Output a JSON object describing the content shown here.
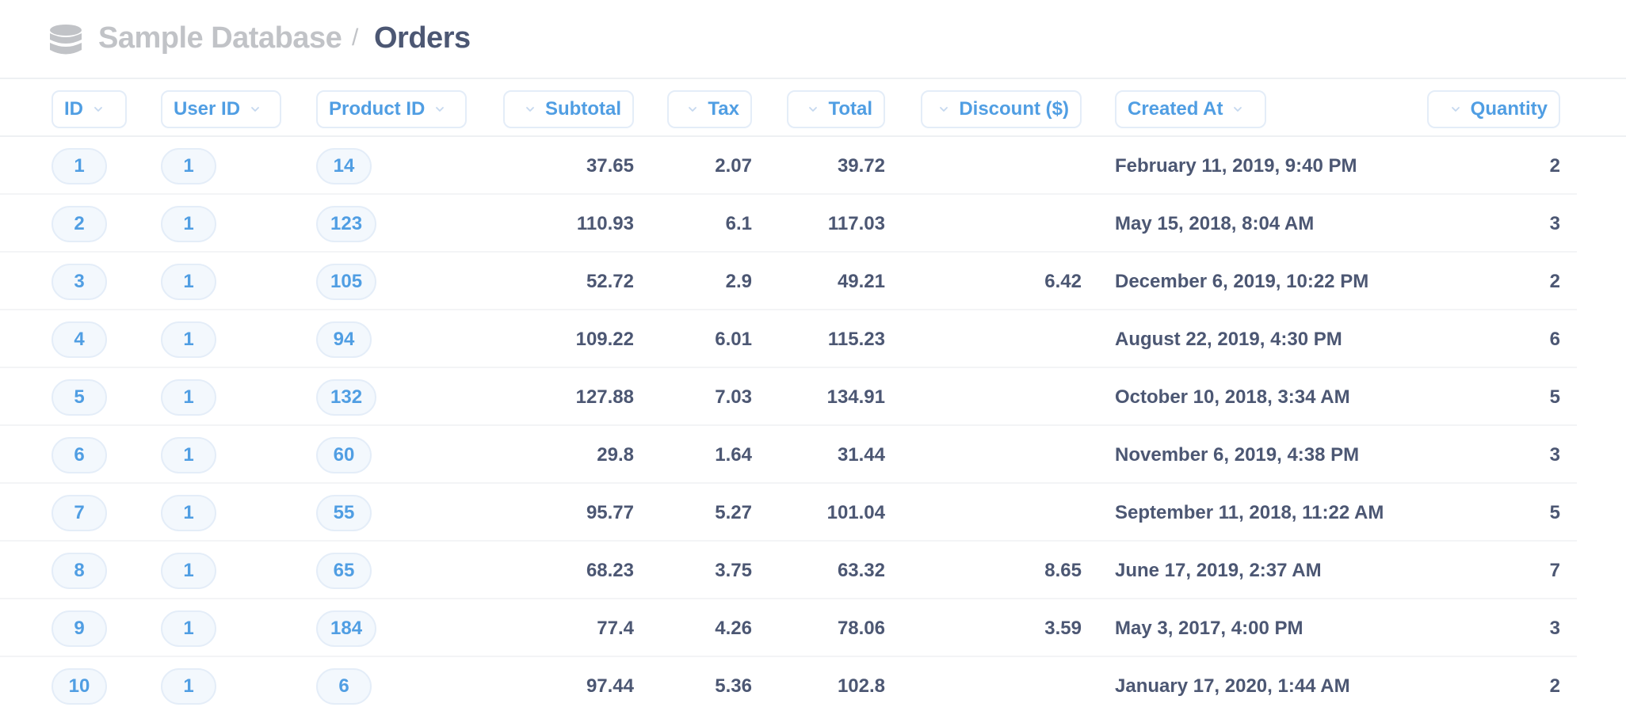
{
  "breadcrumb": {
    "database": "Sample Database",
    "separator": "/",
    "table": "Orders",
    "icon": "database-icon"
  },
  "colors": {
    "accent": "#509ee3",
    "text_dark": "#4c5773",
    "text_muted": "#c1c3c7",
    "pill_bg": "#f3f8fd",
    "pill_border": "#e4edf8"
  },
  "columns": [
    {
      "key": "id",
      "label": "ID",
      "chevron": "after",
      "align": "left"
    },
    {
      "key": "user_id",
      "label": "User ID",
      "chevron": "after",
      "align": "left"
    },
    {
      "key": "product_id",
      "label": "Product ID",
      "chevron": "after",
      "align": "left"
    },
    {
      "key": "subtotal",
      "label": "Subtotal",
      "chevron": "before",
      "align": "right"
    },
    {
      "key": "tax",
      "label": "Tax",
      "chevron": "before",
      "align": "right"
    },
    {
      "key": "total",
      "label": "Total",
      "chevron": "before",
      "align": "right"
    },
    {
      "key": "discount",
      "label": "Discount ($)",
      "chevron": "before",
      "align": "right"
    },
    {
      "key": "created_at",
      "label": "Created At",
      "chevron": "after",
      "align": "left"
    },
    {
      "key": "quantity",
      "label": "Quantity",
      "chevron": "before",
      "align": "right"
    }
  ],
  "rows": [
    {
      "id": "1",
      "user_id": "1",
      "product_id": "14",
      "subtotal": "37.65",
      "tax": "2.07",
      "total": "39.72",
      "discount": "",
      "created_at": "February 11, 2019, 9:40 PM",
      "quantity": "2"
    },
    {
      "id": "2",
      "user_id": "1",
      "product_id": "123",
      "subtotal": "110.93",
      "tax": "6.1",
      "total": "117.03",
      "discount": "",
      "created_at": "May 15, 2018, 8:04 AM",
      "quantity": "3"
    },
    {
      "id": "3",
      "user_id": "1",
      "product_id": "105",
      "subtotal": "52.72",
      "tax": "2.9",
      "total": "49.21",
      "discount": "6.42",
      "created_at": "December 6, 2019, 10:22 PM",
      "quantity": "2"
    },
    {
      "id": "4",
      "user_id": "1",
      "product_id": "94",
      "subtotal": "109.22",
      "tax": "6.01",
      "total": "115.23",
      "discount": "",
      "created_at": "August 22, 2019, 4:30 PM",
      "quantity": "6"
    },
    {
      "id": "5",
      "user_id": "1",
      "product_id": "132",
      "subtotal": "127.88",
      "tax": "7.03",
      "total": "134.91",
      "discount": "",
      "created_at": "October 10, 2018, 3:34 AM",
      "quantity": "5"
    },
    {
      "id": "6",
      "user_id": "1",
      "product_id": "60",
      "subtotal": "29.8",
      "tax": "1.64",
      "total": "31.44",
      "discount": "",
      "created_at": "November 6, 2019, 4:38 PM",
      "quantity": "3"
    },
    {
      "id": "7",
      "user_id": "1",
      "product_id": "55",
      "subtotal": "95.77",
      "tax": "5.27",
      "total": "101.04",
      "discount": "",
      "created_at": "September 11, 2018, 11:22 AM",
      "quantity": "5"
    },
    {
      "id": "8",
      "user_id": "1",
      "product_id": "65",
      "subtotal": "68.23",
      "tax": "3.75",
      "total": "63.32",
      "discount": "8.65",
      "created_at": "June 17, 2019, 2:37 AM",
      "quantity": "7"
    },
    {
      "id": "9",
      "user_id": "1",
      "product_id": "184",
      "subtotal": "77.4",
      "tax": "4.26",
      "total": "78.06",
      "discount": "3.59",
      "created_at": "May 3, 2017, 4:00 PM",
      "quantity": "3"
    },
    {
      "id": "10",
      "user_id": "1",
      "product_id": "6",
      "subtotal": "97.44",
      "tax": "5.36",
      "total": "102.8",
      "discount": "",
      "created_at": "January 17, 2020, 1:44 AM",
      "quantity": "2"
    }
  ]
}
